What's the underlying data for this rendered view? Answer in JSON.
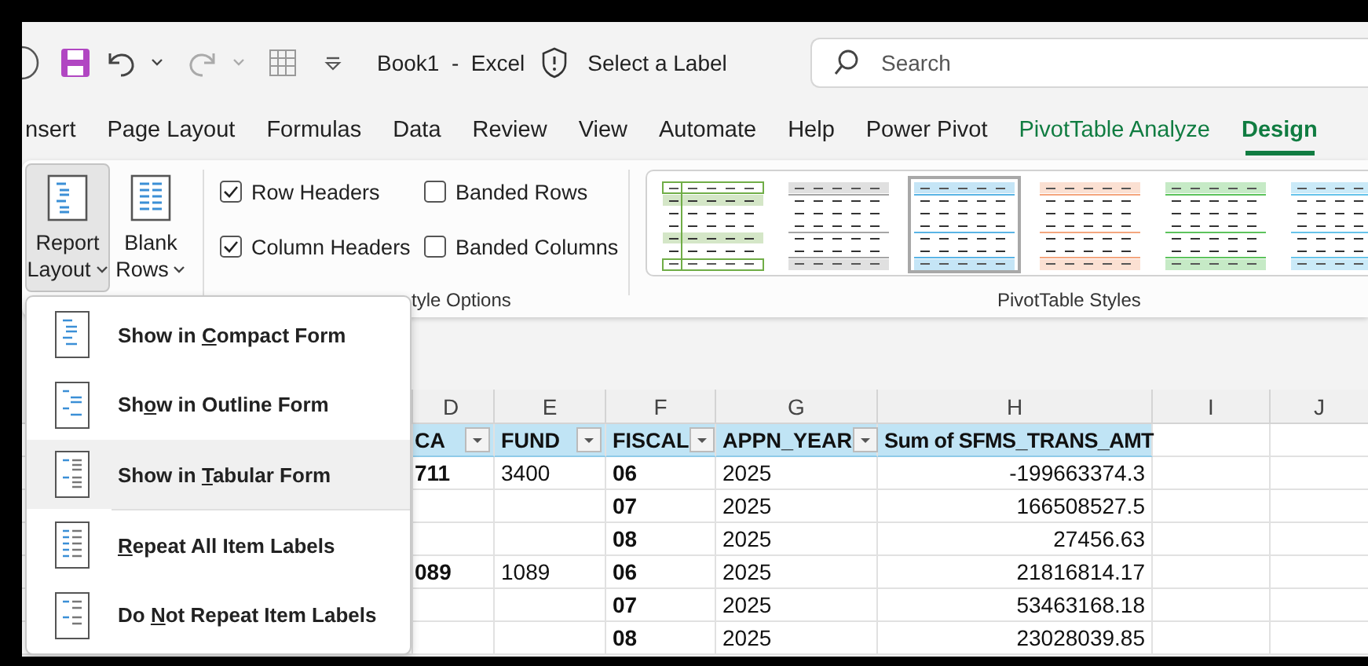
{
  "title_bar": {
    "title": "Book1  -  Excel",
    "label_button": "Select a Label",
    "search": {
      "placeholder": "Search"
    }
  },
  "tabs": [
    {
      "label": "nsert",
      "selected": false,
      "kind": "standard"
    },
    {
      "label": "Page Layout",
      "selected": false,
      "kind": "standard"
    },
    {
      "label": "Formulas",
      "selected": false,
      "kind": "standard"
    },
    {
      "label": "Data",
      "selected": false,
      "kind": "standard"
    },
    {
      "label": "Review",
      "selected": false,
      "kind": "standard"
    },
    {
      "label": "View",
      "selected": false,
      "kind": "standard"
    },
    {
      "label": "Automate",
      "selected": false,
      "kind": "standard"
    },
    {
      "label": "Help",
      "selected": false,
      "kind": "standard"
    },
    {
      "label": "Power Pivot",
      "selected": false,
      "kind": "standard"
    },
    {
      "label": "PivotTable Analyze",
      "selected": false,
      "kind": "contextual"
    },
    {
      "label": "Design",
      "selected": true,
      "kind": "contextual"
    }
  ],
  "ribbon": {
    "layout_buttons": [
      {
        "lines": [
          "Report",
          "Layout"
        ],
        "pressed": true
      },
      {
        "lines": [
          "Blank",
          "Rows"
        ],
        "pressed": false
      }
    ],
    "style_options": [
      {
        "label": "Row Headers",
        "checked": true
      },
      {
        "label": "Banded Rows",
        "checked": false
      },
      {
        "label": "Column Headers",
        "checked": true
      },
      {
        "label": "Banded Columns",
        "checked": false
      }
    ],
    "style_options_label": "tyle Options",
    "pivot_styles": [
      {
        "kind": "outlined",
        "color": "#70ad47",
        "selected": false
      },
      {
        "kind": "banded",
        "color": "#a5a5a5",
        "selected": false
      },
      {
        "kind": "banded",
        "color": "#5ab4e5",
        "selected": true
      },
      {
        "kind": "banded",
        "color": "#f4a67e",
        "selected": false
      },
      {
        "kind": "banded",
        "color": "#5cc35c",
        "selected": false
      },
      {
        "kind": "banded",
        "color": "#66c3ea",
        "selected": false
      }
    ],
    "pivot_styles_label": "PivotTable Styles"
  },
  "sheet": {
    "columns": [
      "D",
      "E",
      "F",
      "G",
      "H",
      "I",
      "J"
    ],
    "header": [
      {
        "text": "CA",
        "filter": true
      },
      {
        "text": "FUND",
        "filter": true
      },
      {
        "text": "FISCAL",
        "filter": true
      },
      {
        "text": "APPN_YEAR",
        "filter": true
      },
      {
        "text": "Sum of SFMS_TRANS_AMT",
        "filter": false
      }
    ],
    "rows": [
      [
        "711",
        "3400",
        "06",
        "2025",
        "-199663374.3"
      ],
      [
        "",
        "",
        "07",
        "2025",
        "166508527.5"
      ],
      [
        "",
        "",
        "08",
        "2025",
        "27456.63"
      ],
      [
        "089",
        "1089",
        "06",
        "2025",
        "21816814.17"
      ],
      [
        "",
        "",
        "07",
        "2025",
        "53463168.18"
      ],
      [
        "",
        "",
        "08",
        "2025",
        "23028039.85"
      ]
    ]
  },
  "report_layout_menu": {
    "form_items": [
      {
        "kind": "compact",
        "before": "Show in ",
        "key": "C",
        "after": "ompact Form",
        "highlighted": false
      },
      {
        "kind": "outline",
        "before": "Sh",
        "key": "o",
        "after": "w in Outline Form",
        "highlighted": false
      },
      {
        "kind": "tabular",
        "before": "Show in ",
        "key": "T",
        "after": "abular Form",
        "highlighted": true
      }
    ],
    "label_items": [
      {
        "kind": "repeat",
        "key": "R",
        "after": "epeat All Item Labels",
        "highlighted": false
      },
      {
        "kind": "norepeat",
        "before": "Do ",
        "key": "N",
        "after": "ot Repeat Item Labels",
        "highlighted": false
      }
    ]
  }
}
